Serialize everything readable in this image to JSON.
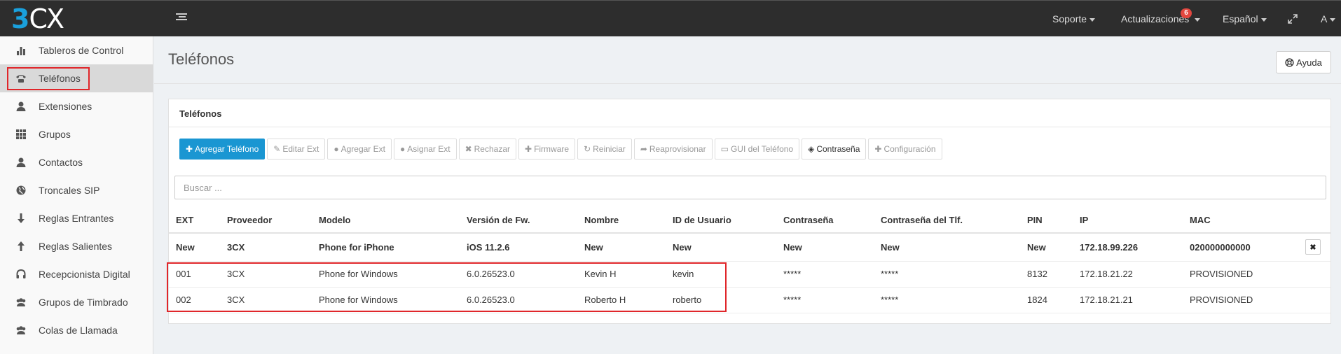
{
  "app": {
    "logo_3": "3",
    "logo_cx": "CX",
    "brand_color": "#1aa0dc"
  },
  "topnav": {
    "support": "Soporte",
    "updates": "Actualizaciones",
    "updates_badge": "6",
    "language": "Español",
    "user": "A"
  },
  "sidebar": {
    "items": [
      {
        "label": "Tableros de Control",
        "icon": "bar-chart-icon"
      },
      {
        "label": "Teléfonos",
        "icon": "phone-icon",
        "active": true
      },
      {
        "label": "Extensiones",
        "icon": "user-icon"
      },
      {
        "label": "Grupos",
        "icon": "grid-icon"
      },
      {
        "label": "Contactos",
        "icon": "user-icon"
      },
      {
        "label": "Troncales SIP",
        "icon": "globe-icon"
      },
      {
        "label": "Reglas Entrantes",
        "icon": "arrow-down-icon"
      },
      {
        "label": "Reglas Salientes",
        "icon": "arrow-up-icon"
      },
      {
        "label": "Recepcionista Digital",
        "icon": "headset-icon"
      },
      {
        "label": "Grupos de Timbrado",
        "icon": "users-icon"
      },
      {
        "label": "Colas de Llamada",
        "icon": "users-icon"
      }
    ]
  },
  "page": {
    "title": "Teléfonos",
    "help_label": "Ayuda"
  },
  "panel": {
    "title": "Teléfonos",
    "toolbar": {
      "add_phone": "Agregar Teléfono",
      "edit_ext": "Editar Ext",
      "add_ext": "Agregar Ext",
      "assign_ext": "Asignar Ext",
      "reject": "Rechazar",
      "firmware": "Firmware",
      "restart": "Reiniciar",
      "reprovision": "Reaprovisionar",
      "phone_gui": "GUI del Teléfono",
      "password": "Contraseña",
      "config": "Configuración"
    },
    "search_placeholder": "Buscar ..."
  },
  "table": {
    "headers": [
      "EXT",
      "Proveedor",
      "Modelo",
      "Versión de Fw.",
      "Nombre",
      "ID de Usuario",
      "Contraseña",
      "Contraseña del Tlf.",
      "PIN",
      "IP",
      "MAC"
    ],
    "new_row": [
      "New",
      "3CX",
      "Phone for iPhone",
      "iOS 11.2.6",
      "New",
      "New",
      "New",
      "New",
      "New",
      "172.18.99.226",
      "020000000000"
    ],
    "rows": [
      [
        "001",
        "3CX",
        "Phone for Windows",
        "6.0.26523.0",
        "Kevin H",
        "kevin",
        "*****",
        "*****",
        "8132",
        "172.18.21.22",
        "PROVISIONED"
      ],
      [
        "002",
        "3CX",
        "Phone for Windows",
        "6.0.26523.0",
        "Roberto H",
        "roberto",
        "*****",
        "*****",
        "1824",
        "172.18.21.21",
        "PROVISIONED"
      ]
    ]
  }
}
